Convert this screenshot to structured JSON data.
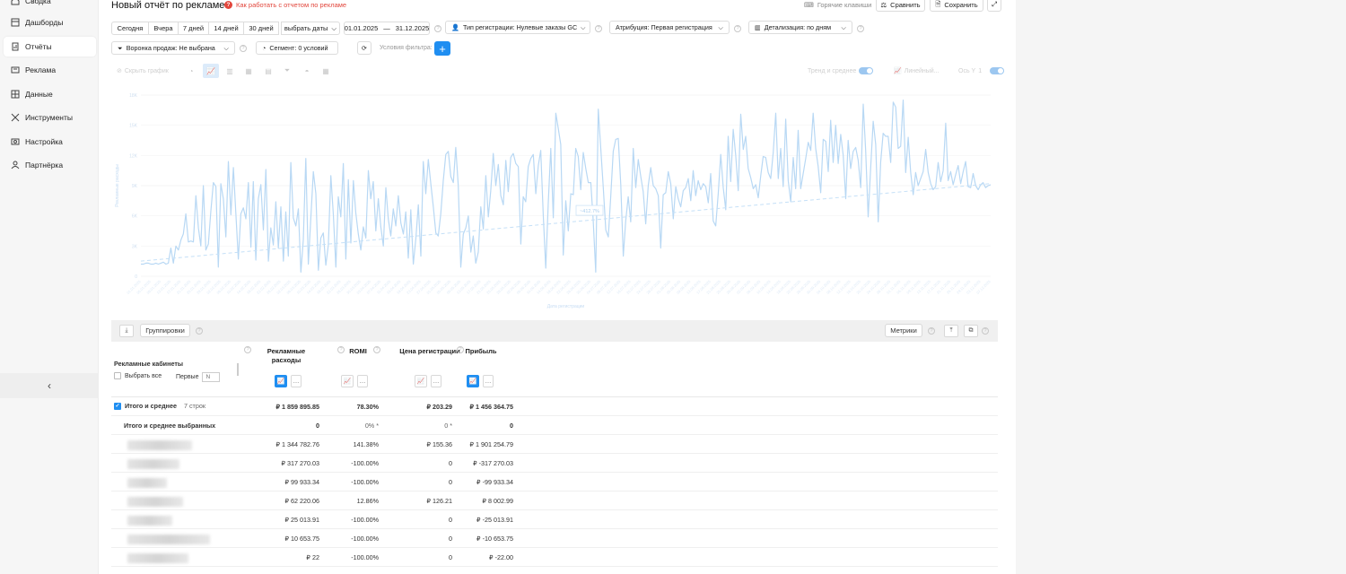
{
  "sidebar": {
    "items": [
      {
        "label": "Сводка",
        "icon": "home-icon",
        "active": false
      },
      {
        "label": "Дашборды",
        "icon": "dashboard-icon",
        "active": false
      },
      {
        "label": "Отчёты",
        "icon": "report-icon",
        "active": true
      },
      {
        "label": "Реклама",
        "icon": "ads-icon",
        "active": false
      },
      {
        "label": "Данные",
        "icon": "data-icon",
        "active": false
      },
      {
        "label": "Инструменты",
        "icon": "tools-icon",
        "active": false
      },
      {
        "label": "Настройка",
        "icon": "settings-icon",
        "active": false
      },
      {
        "label": "Партнёрка",
        "icon": "partner-icon",
        "active": false
      }
    ],
    "collapse_icon": "‹"
  },
  "header": {
    "title": "Новый отчёт по рекламе",
    "howto_label": "Как работать с отчетом по рекламе",
    "hotkeys_label": "Горячие клавиши",
    "compare_label": "Сравнить",
    "save_label": "Сохранить",
    "expand_icon": "⤢"
  },
  "periods": [
    "Сегодня",
    "Вчера",
    "7 дней",
    "14 дней",
    "30 дней"
  ],
  "date_picker": {
    "label": "выбрать даты",
    "from": "01.01.2025",
    "to": "31.12.2025",
    "sep": "—"
  },
  "filters": {
    "reg_type": "Тип регистрации: Нулевые заказы GC",
    "attribution": "Атрибуция: Первая регистрация",
    "detail": "Детализация:  по дням",
    "funnel": "Воронка продаж: Не выбрана",
    "segment": "Сегмент: 0 условий",
    "conditions": "Условия фильтра:"
  },
  "chart_toolbar": {
    "hide_label": "Скрыть график",
    "trend_label": "Тренд и среднее",
    "linear_label": "Линейный...",
    "axis_label": "Ось Y",
    "axis_value": "1"
  },
  "chart_data": {
    "type": "line",
    "ylim": [
      0,
      18000
    ],
    "yticks": [
      "0",
      "3K",
      "6K",
      "9K",
      "12K",
      "15K",
      "18K"
    ],
    "ylabel": "Рекламные расходы",
    "xlabel": "Дата регистрации",
    "annotation": "~412.7%",
    "series": [
      {
        "values": [
          1200,
          1200,
          1300,
          1300,
          1200,
          1200,
          1300,
          1200,
          1300,
          1400,
          1200,
          1300,
          2800,
          1300,
          3000,
          2600,
          3600,
          4200,
          6200,
          3400,
          3500,
          3400,
          8000,
          4800,
          3000,
          9000,
          2600,
          3200,
          6500,
          9300,
          8900,
          900,
          9200,
          7700,
          3900,
          11400,
          6100,
          10800,
          6300,
          1700,
          6200,
          6800,
          5700,
          9300,
          2900,
          9400,
          1600,
          7700,
          9100,
          4600,
          10600,
          1500,
          4800,
          3100,
          7400,
          2800,
          6900,
          1500,
          6400,
          2000,
          11300,
          5800,
          5000,
          6700,
          400,
          3600,
          11700,
          1200,
          5800,
          10400,
          8200,
          600,
          3800,
          4300,
          1100,
          3100,
          10000,
          6100,
          900,
          7900,
          5900,
          11200,
          1700,
          9600,
          3300,
          9500,
          6300,
          4200,
          2600,
          4900,
          3800,
          10500,
          7700,
          9400,
          4500,
          7700,
          4900,
          3000,
          8800,
          5700,
          4000,
          6700,
          5000,
          8000,
          5300,
          4200,
          6400,
          1800,
          6600,
          1200,
          3700,
          7100,
          2000,
          11400,
          8200,
          11600,
          9200,
          6900,
          4300,
          4000,
          6200,
          9500,
          12100,
          12400,
          9900,
          9300,
          12800,
          9000,
          900,
          4200,
          4800,
          6000,
          2400,
          4000,
          1300,
          2400,
          6900,
          4700,
          10000,
          5900,
          8500,
          12200,
          9000,
          11100,
          8000,
          7100,
          11500,
          8400,
          11800,
          12200,
          11200,
          10900,
          3200,
          7900,
          7400,
          10900,
          11700,
          12100,
          8200,
          11000,
          12500,
          6100,
          800,
          7300,
          12700,
          5800,
          16200,
          14700,
          13100,
          2100,
          7500,
          4500,
          8200,
          8100,
          12700,
          11900,
          8600,
          12300,
          10700,
          9300,
          9300,
          5500,
          400,
          16600,
          12700,
          8800,
          4600,
          3900,
          7900,
          12400,
          13600,
          13700,
          9100,
          2000,
          5500,
          7900,
          5400,
          12700,
          8800,
          11600,
          9900,
          8400,
          5200,
          9000,
          10800,
          9000,
          8700,
          8000,
          2800,
          8100,
          8300,
          10400,
          9200,
          5700,
          8900,
          7700,
          6900,
          8500,
          8800,
          9700,
          7500,
          10500,
          8000,
          9500,
          8600,
          9200,
          8900,
          7300,
          10200,
          5500,
          5000,
          8200,
          12100,
          8800,
          6600,
          13900,
          9400,
          14600,
          12000,
          8500,
          16100,
          12600,
          13900,
          10700,
          9800,
          8700,
          9100,
          7800,
          10000,
          11900,
          11800,
          10300,
          9700,
          12300,
          16200,
          9700,
          12700,
          8900,
          15600,
          9500,
          7400,
          11800,
          8700,
          14500,
          8700,
          10200,
          11700,
          13300,
          12500,
          16200,
          12700,
          10900,
          8300,
          13600,
          13400,
          10400,
          15500,
          11300,
          15000,
          11200,
          14100,
          12000,
          7700,
          13500,
          10700,
          12400,
          12800,
          11500,
          8800,
          17100,
          12500,
          5900,
          10800,
          15400,
          13100,
          5400,
          11300,
          14200,
          13900,
          13900,
          11300,
          17300,
          16800,
          12700,
          12900,
          17500,
          10300,
          13800,
          10300,
          8100,
          10300,
          9000,
          9700,
          10400,
          12600,
          10300,
          9200,
          8600,
          8900,
          11300,
          9400,
          10500,
          15200,
          9500,
          10400,
          9100,
          10100,
          11000,
          9200,
          10400,
          11400,
          8900,
          8800,
          10200,
          9000,
          8600,
          9100,
          9300,
          8800,
          9000,
          9100
        ]
      }
    ],
    "trend": [
      1500,
      9200
    ],
    "grid": true
  },
  "table": {
    "groups_label": "Группировки",
    "metrics_label": "Метрики",
    "first_col": "Рекламные кабинеты",
    "select_all": "Выбрать все",
    "first_label": "Первые",
    "first_placeholder": "N",
    "columns": [
      {
        "label": "Рекламные расходы"
      },
      {
        "label": "ROMI"
      },
      {
        "label": "Цена регистрации"
      },
      {
        "label": "Прибыль"
      }
    ],
    "total": {
      "label": "Итого и среднее",
      "count": "7 строк",
      "values": [
        "₽ 1 859 895.85",
        "78.30%",
        "₽ 203.29",
        "₽ 1 456 364.75"
      ]
    },
    "selected": {
      "label": "Итого и среднее выбранных",
      "values": [
        "0",
        "0% *",
        "0 *",
        "0"
      ]
    },
    "rows": [
      [
        "₽ 1 344 782.76",
        "141.38%",
        "₽ 155.36",
        "₽ 1 901 254.79"
      ],
      [
        "₽ 317 270.03",
        "-100.00%",
        "0",
        "₽ -317 270.03"
      ],
      [
        "₽ 99 933.34",
        "-100.00%",
        "0",
        "₽ -99 933.34"
      ],
      [
        "₽ 62 220.06",
        "12.86%",
        "₽ 126.21",
        "₽ 8 002.99"
      ],
      [
        "₽ 25 013.91",
        "-100.00%",
        "0",
        "₽ -25 013.91"
      ],
      [
        "₽ 10 653.75",
        "-100.00%",
        "0",
        "₽ -10 653.75"
      ],
      [
        "₽ 22",
        "-100.00%",
        "0",
        "₽ -22.00"
      ]
    ]
  }
}
